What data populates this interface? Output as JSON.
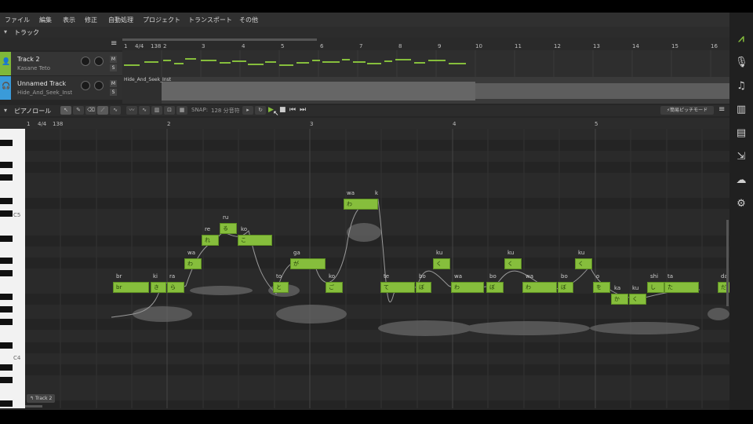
{
  "menu": [
    "ファイル",
    "編集",
    "表示",
    "修正",
    "自動処理",
    "プロジェクト",
    "トランスポート",
    "その他"
  ],
  "tracks_header": {
    "label": "トラック"
  },
  "tracks": [
    {
      "name": "Track 2",
      "sub": "Kasane Teto",
      "color": "#7fb83a"
    },
    {
      "name": "Unnamed Track",
      "sub": "Hide_And_Seek_Inst",
      "color": "#3a9bd9"
    }
  ],
  "mute_label": "M",
  "solo_label": "S",
  "arranger": {
    "ruler": [
      "1",
      "4/4",
      "138",
      "2",
      "3",
      "4",
      "5",
      "6",
      "7",
      "8",
      "9",
      "10",
      "11",
      "12",
      "13",
      "14",
      "15",
      "16"
    ],
    "audio_clip_label": "Hide_And_Seek_Inst"
  },
  "pianoroll": {
    "label": "ピアノロール",
    "snap_label": "SNAP:",
    "snap_value": "128 分音符",
    "pitch_mode": "簡易ピッチモード",
    "ruler": [
      "1",
      "4/4",
      "138",
      "2",
      "3",
      "4",
      "5"
    ],
    "key_labels": [
      "C5",
      "C4"
    ],
    "track_tag": "Track 2"
  },
  "notes": [
    {
      "lyric": "br",
      "text": "br"
    },
    {
      "lyric": "ki",
      "text": "き"
    },
    {
      "lyric": "ra",
      "text": "ら"
    },
    {
      "lyric": "wa",
      "text": "わ"
    },
    {
      "lyric": "re",
      "text": "れ"
    },
    {
      "lyric": "ru",
      "text": "る"
    },
    {
      "lyric": "ko",
      "text": "こ"
    },
    {
      "lyric": "to",
      "text": "と"
    },
    {
      "lyric": "ga",
      "text": "が"
    },
    {
      "lyric": "ko",
      "text": "ご"
    },
    {
      "lyric": "wa",
      "text": "わ"
    },
    {
      "lyric": "k",
      "text": ""
    },
    {
      "lyric": "te",
      "text": "て"
    },
    {
      "lyric": "bo",
      "text": "ぼ"
    },
    {
      "lyric": "ku",
      "text": "く"
    },
    {
      "lyric": "wa",
      "text": "わ"
    },
    {
      "lyric": "bo",
      "text": "ぼ"
    },
    {
      "lyric": "ku",
      "text": "く"
    },
    {
      "lyric": "wa",
      "text": "わ"
    },
    {
      "lyric": "bo",
      "text": "ぼ"
    },
    {
      "lyric": "ku",
      "text": "く"
    },
    {
      "lyric": "o",
      "text": "を"
    },
    {
      "lyric": "ka",
      "text": "か"
    },
    {
      "lyric": "ku",
      "text": "く"
    },
    {
      "lyric": "shi",
      "text": "し"
    },
    {
      "lyric": "ta",
      "text": "た"
    },
    {
      "lyric": "da",
      "text": "だ"
    }
  ],
  "sidebar_icons": [
    "logo-icon",
    "microphone-icon",
    "music-note-icon",
    "library-icon",
    "book-icon",
    "export-icon",
    "cloud-icon",
    "gear-icon"
  ]
}
